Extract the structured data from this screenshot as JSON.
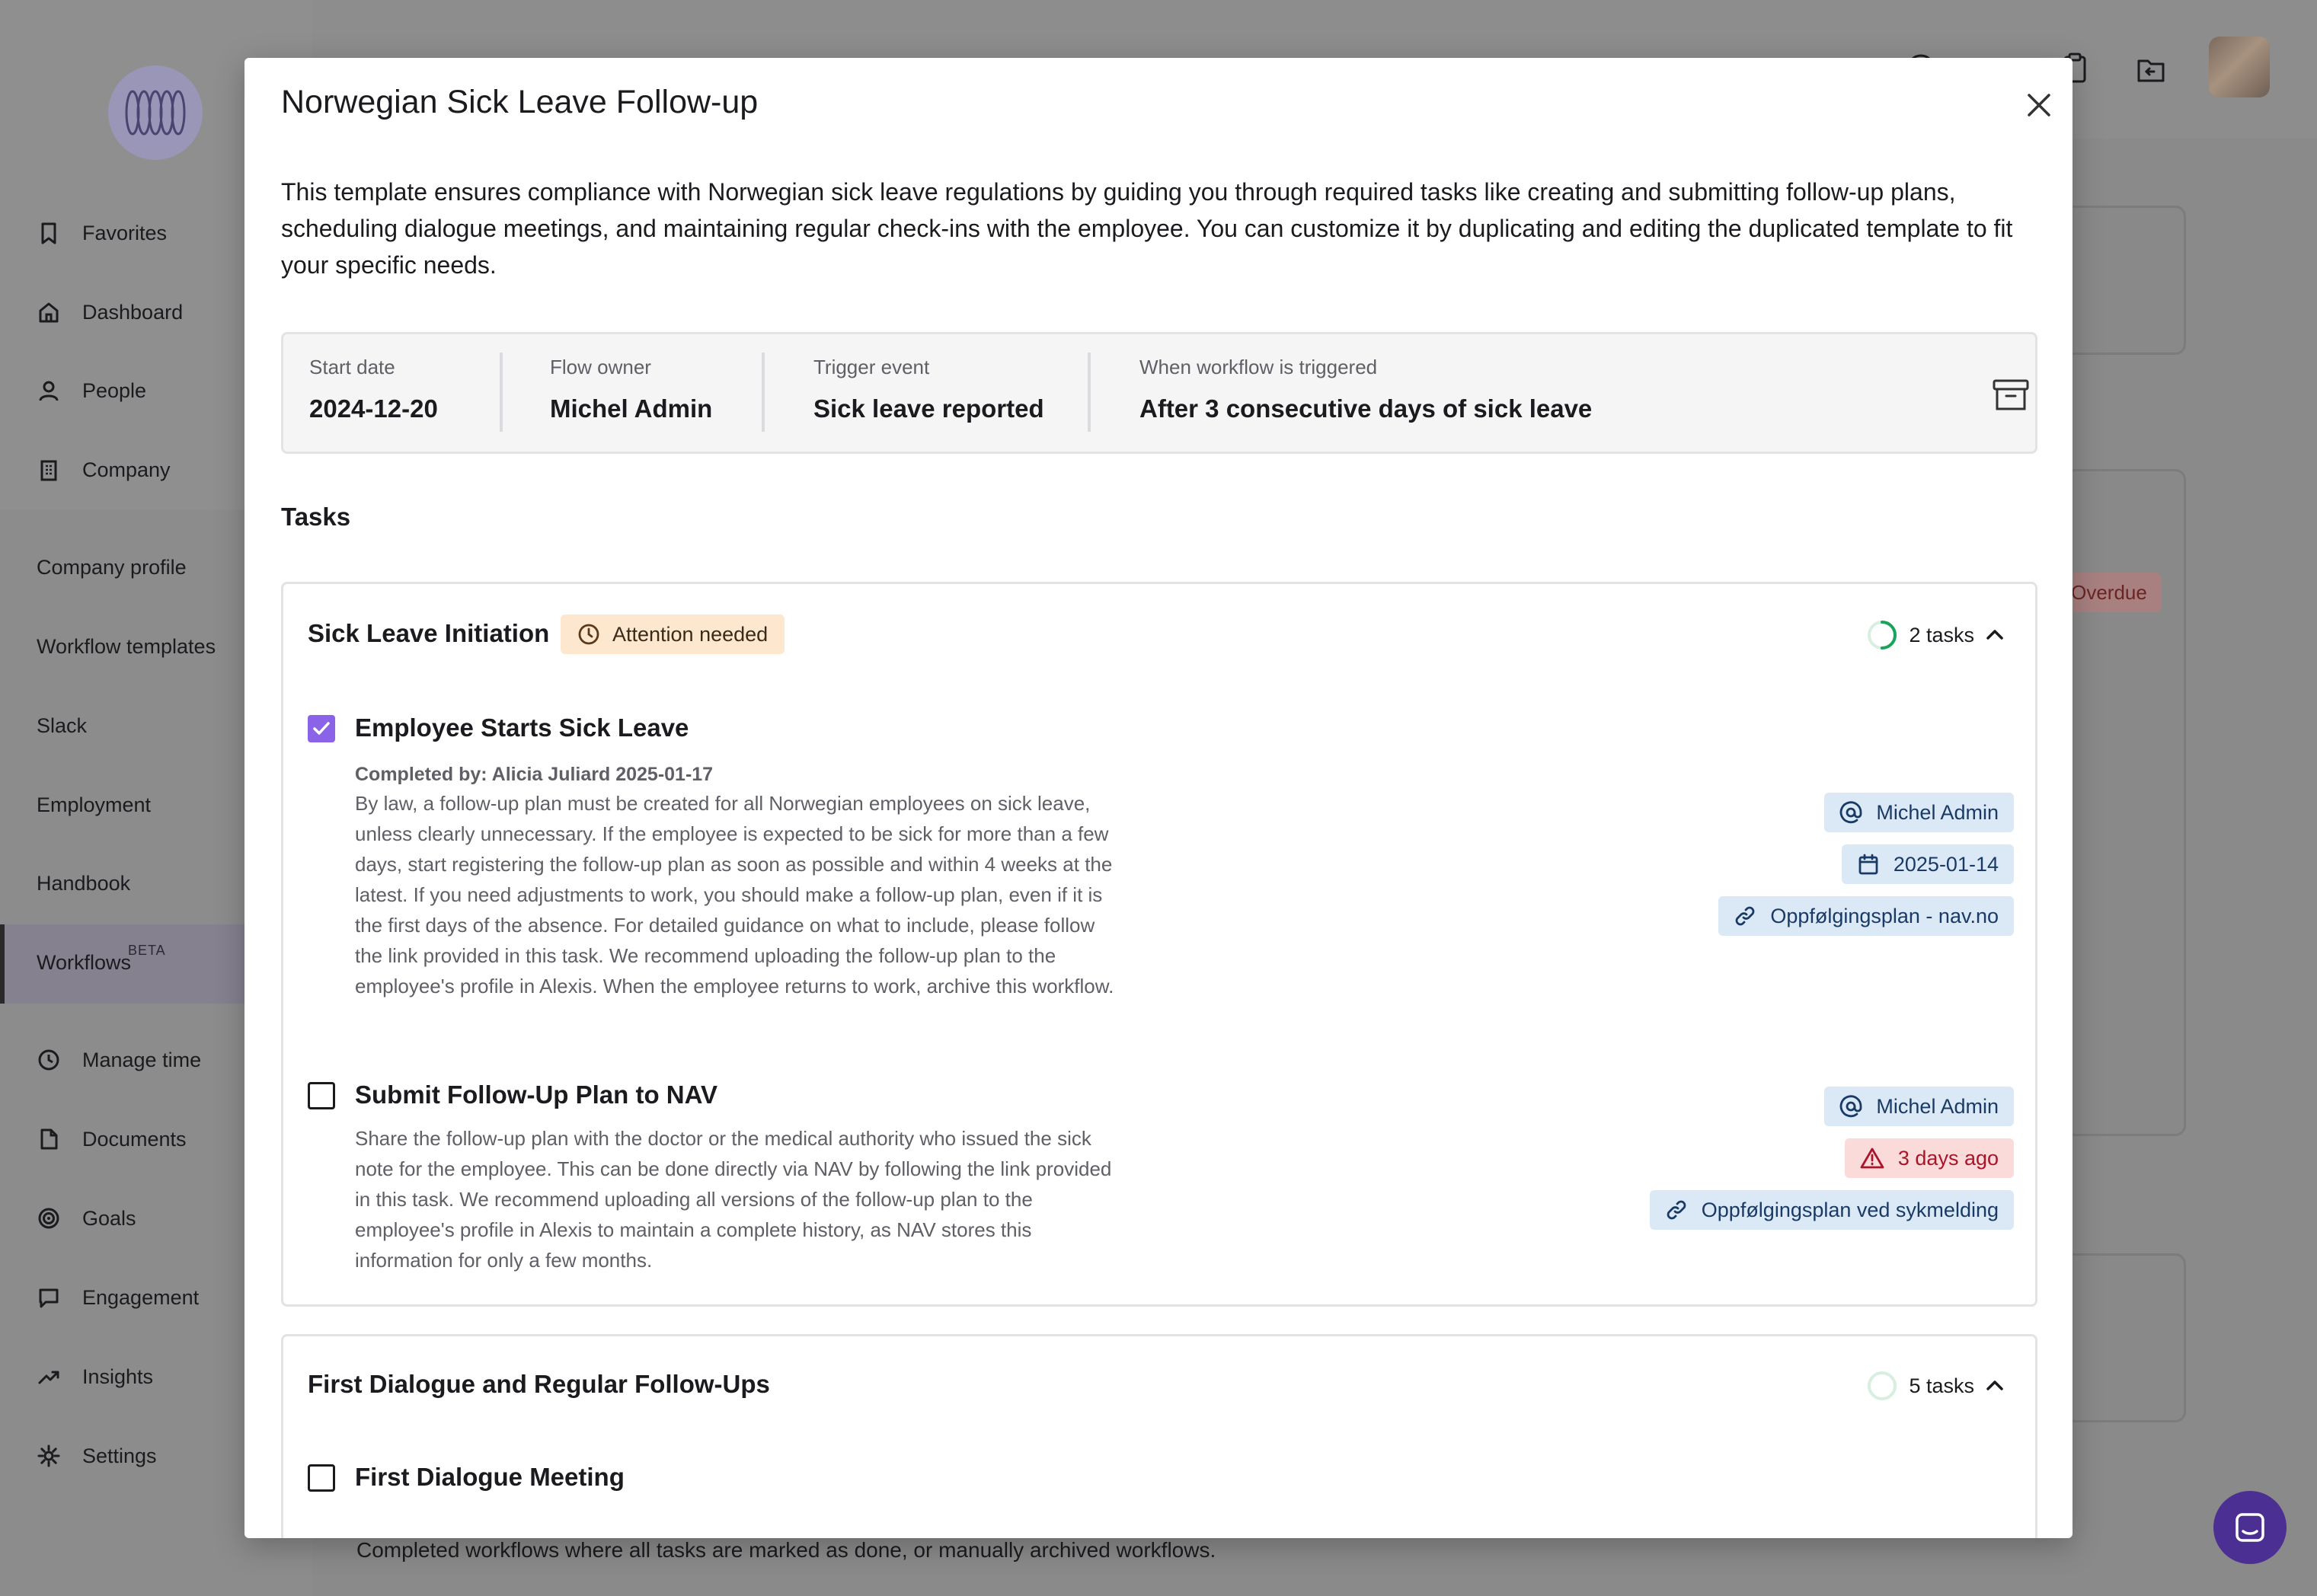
{
  "sidebar": {
    "items": [
      {
        "label": "Favorites",
        "icon": "bookmark-icon"
      },
      {
        "label": "Dashboard",
        "icon": "home-icon"
      },
      {
        "label": "People",
        "icon": "person-icon"
      },
      {
        "label": "Company",
        "icon": "building-icon"
      },
      {
        "label": "Company profile"
      },
      {
        "label": "Workflow templates"
      },
      {
        "label": "Slack"
      },
      {
        "label": "Employment"
      },
      {
        "label": "Handbook"
      },
      {
        "label": "Workflows",
        "badge": "BETA"
      },
      {
        "label": "Manage time",
        "icon": "clock-icon"
      },
      {
        "label": "Documents",
        "icon": "document-icon"
      },
      {
        "label": "Goals",
        "icon": "target-icon"
      },
      {
        "label": "Engagement",
        "icon": "chat-bubble-icon"
      },
      {
        "label": "Insights",
        "icon": "trend-icon"
      },
      {
        "label": "Settings",
        "icon": "gear-icon"
      }
    ]
  },
  "background": {
    "overdue_label": "Overdue",
    "footer_text": "Completed workflows where all tasks are marked as done, or manually archived workflows."
  },
  "modal": {
    "title": "Norwegian Sick Leave Follow-up",
    "description": "This template ensures compliance with Norwegian sick leave regulations by guiding you through required tasks like creating and submitting follow-up plans, scheduling dialogue meetings, and maintaining regular check-ins with the employee. You can customize it by duplicating and editing the duplicated template to fit your specific needs.",
    "info": {
      "start_date_label": "Start date",
      "start_date": "2024-12-20",
      "owner_label": "Flow owner",
      "owner": "Michel Admin",
      "trigger_label": "Trigger event",
      "trigger": "Sick leave reported",
      "when_label": "When workflow is triggered",
      "when": "After 3 consecutive days of sick leave"
    },
    "tasks_heading": "Tasks",
    "groups": [
      {
        "title": "Sick Leave Initiation",
        "status": "Attention needed",
        "count": "2 tasks",
        "progress": 0.5,
        "tasks": [
          {
            "title": "Employee Starts Sick Leave",
            "checked": true,
            "completed_by": "Completed by: Alicia Juliard 2025-01-17",
            "description": "By law, a follow-up plan must be created for all Norwegian employees on sick leave, unless clearly unnecessary. If the employee is expected to be sick for more than a few days, start registering the follow-up plan as soon as possible and within 4 weeks at the latest. If you need adjustments to work, you should make a follow-up plan, even if it is the first days of the absence. For detailed guidance on what to include, please follow the link provided in this task. We recommend uploading the follow-up plan to the employee's profile in Alexis. When the employee returns to work, archive this workflow.",
            "assignee": "Michel Admin",
            "due": "2025-01-14",
            "link": "Oppfølgingsplan - nav.no"
          },
          {
            "title": "Submit Follow-Up Plan to NAV",
            "checked": false,
            "description": "Share the follow-up plan with the doctor or the medical authority who issued the sick note for the employee. This can be done directly via NAV by following the link provided in this task. We recommend uploading all versions of the follow-up plan to the employee's profile in Alexis to maintain a complete history, as NAV stores this information for only a few months.",
            "assignee": "Michel Admin",
            "due": "3 days ago",
            "link": "Oppfølgingsplan ved sykmelding"
          }
        ]
      },
      {
        "title": "First Dialogue and Regular Follow-Ups",
        "count": "5 tasks",
        "progress": 0,
        "tasks": [
          {
            "title": "First Dialogue Meeting",
            "checked": false
          }
        ]
      }
    ]
  },
  "colors": {
    "accent": "#8b63e8",
    "attention_bg": "#fde7cf",
    "chip_blue_bg": "#dbe9f7",
    "chip_red_bg": "#fbdada",
    "progress_green": "#1aa35a",
    "chat_button": "#4b2f92"
  }
}
